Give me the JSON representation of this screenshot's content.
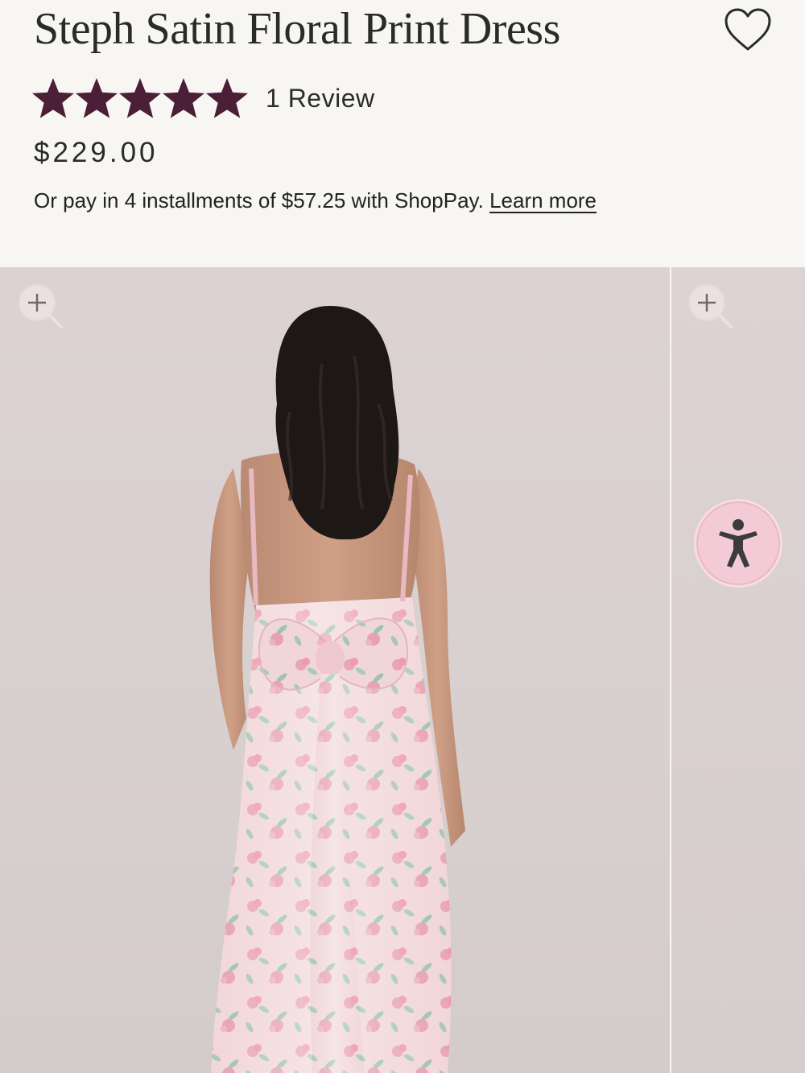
{
  "product": {
    "title": "Steph Satin Floral Print Dress",
    "rating_value": 5,
    "rating_max": 5,
    "review_count_label": "1 Review",
    "price": "$229.00",
    "installments_text": "Or pay in 4 installments of $57.25 with ShopPay.",
    "installments_link": "Learn more"
  },
  "colors": {
    "star": "#4a1f37",
    "background": "#f7f6f3",
    "accessibility_bg": "#f3cbd6"
  },
  "icons": {
    "wishlist": "heart-outline-icon",
    "zoom": "zoom-in-icon",
    "accessibility": "accessibility-person-icon"
  },
  "gallery": {
    "images": [
      {
        "description_icon": "dress-back-view-photo"
      },
      {
        "description_icon": "dress-photo-partial"
      }
    ]
  }
}
